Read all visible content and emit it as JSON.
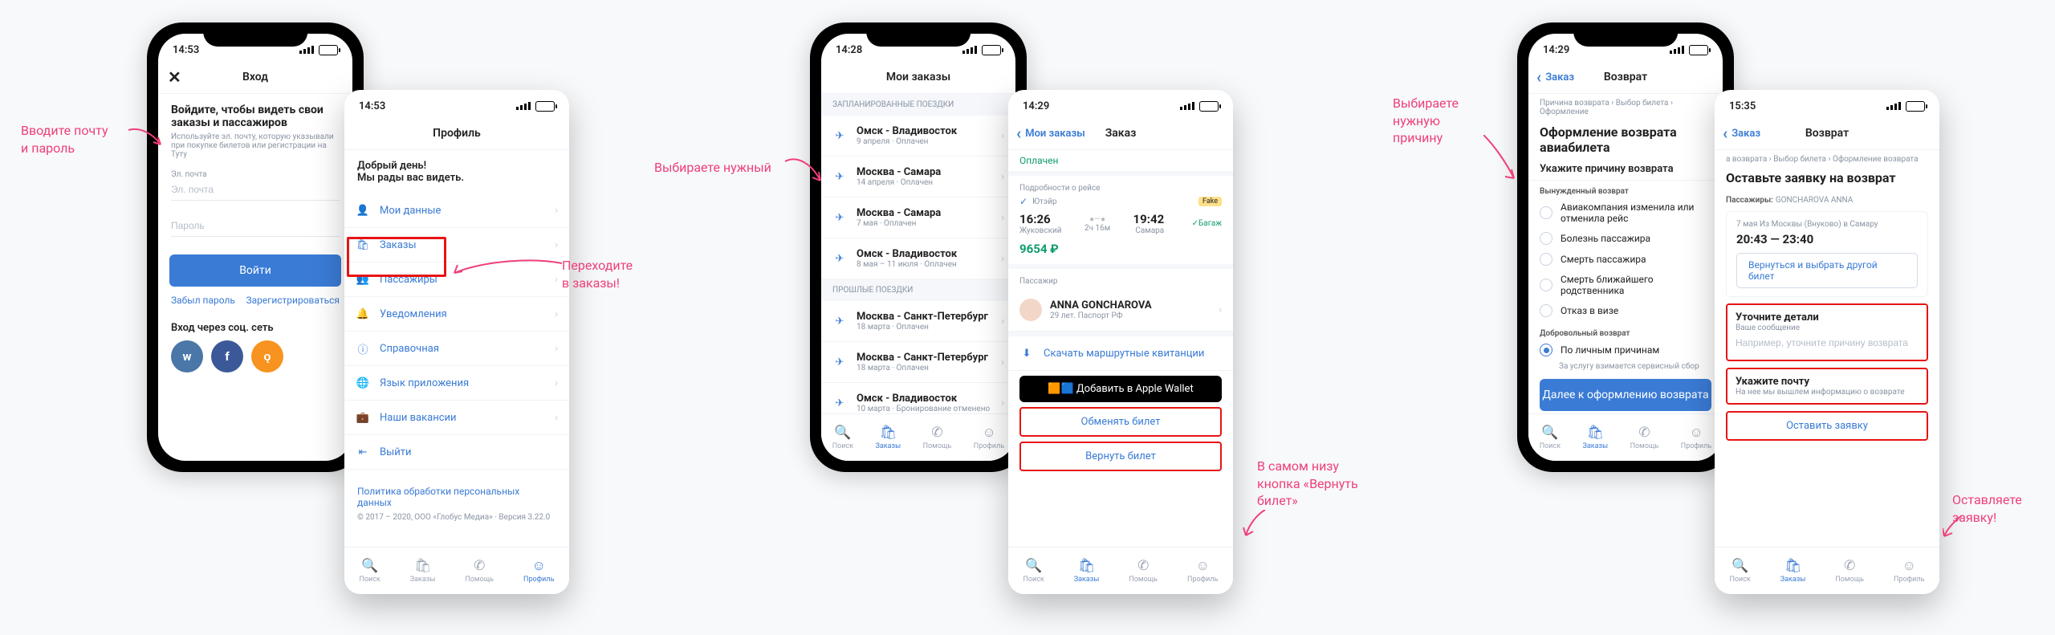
{
  "annotations": {
    "a1": "Вводите почту\nи пароль",
    "a2": "Переходите\nв заказы!",
    "a3": "Выбираете нужный",
    "a4": "В самом низу\nкнопка «Вернуть\nбилет»",
    "a5": "Выбираете\nнужную\nпричину",
    "a6": "Оставляете\nзаявку!"
  },
  "login": {
    "time": "14:53",
    "title": "Вход",
    "heading": "Войдите, чтобы видеть свои\nзаказы и пассажиров",
    "sub": "Используйте эл. почту, которую указывали при покупке билетов или регистрации на Туту",
    "email_label": "Эл. почта",
    "pass_label": "Пароль",
    "btn": "Войти",
    "forgot": "Забыл пароль",
    "register": "Зарегистрироваться",
    "social_label": "Вход через соц. сеть"
  },
  "profile": {
    "time": "14:53",
    "title": "Профиль",
    "greet": "Добрый день!\nМы рады вас видеть.",
    "items": [
      "Мои данные",
      "Заказы",
      "Пассажиры",
      "Уведомления",
      "Справочная",
      "Язык приложения",
      "Наши вакансии",
      "Выйти"
    ],
    "policy": "Политика обработки персональных данных",
    "copyright": "© 2017 – 2020, ООО «Глобус Медиа» · Версия 3.22.0",
    "tabs": [
      "Поиск",
      "Заказы",
      "Помощь",
      "Профиль"
    ]
  },
  "orders": {
    "time": "14:28",
    "title": "Мои заказы",
    "sect1": "ЗАПЛАНИРОВАННЫЕ ПОЕЗДКИ",
    "trips": [
      {
        "route": "Омск - Владивосток",
        "sub": "9 апреля · Оплачен"
      },
      {
        "route": "Москва - Самара",
        "sub": "14 апреля · Оплачен"
      },
      {
        "route": "Москва - Самара",
        "sub": "7 мая · Оплачен"
      },
      {
        "route": "Омск - Владивосток",
        "sub": "8 мая – 11 июля · Оплачен"
      }
    ],
    "sect2": "ПРОШЛЫЕ ПОЕЗДКИ",
    "past": [
      {
        "route": "Москва - Санкт-Петербург",
        "sub": "18 марта · Оплачен"
      },
      {
        "route": "Москва - Санкт-Петербург",
        "sub": "18 марта · Оплачен"
      },
      {
        "route": "Омск - Владивосток",
        "sub": "10 марта · Бронирование отменено"
      }
    ]
  },
  "order": {
    "time": "14:29",
    "back": "Мои заказы",
    "title": "Заказ",
    "status": "Оплачен",
    "detail_head": "Подробности о рейсе",
    "fake": "Fake",
    "carrier": "Ютэйр",
    "dep_t": "16:26",
    "dep_c": "Жуковский",
    "dur": "2ч 16м",
    "arr_t": "19:42",
    "arr_c": "Самара",
    "baggage": "Багаж",
    "price": "9654 ₽",
    "pax_head": "Пассажир",
    "pax_name": "ANNA GONCHAROVA",
    "pax_sub": "29 лет. Паспорт РФ",
    "download": "Скачать маршрутные квитанции",
    "wallet": "Добавить в Apple Wallet",
    "exchange": "Обменять билет",
    "return": "Вернуть билет",
    "tabs": [
      "Поиск",
      "Заказы",
      "Помощь",
      "Профиль"
    ]
  },
  "reason": {
    "time": "14:29",
    "back": "Заказ",
    "title": "Возврат",
    "crumb": "Причина возврата › Выбор билета › Оформление",
    "heading": "Оформление возврата\nавиабилета",
    "prompt": "Укажите причину возврата",
    "forced": "Вынужденный возврат",
    "opts": [
      "Авиакомпания изменила или отменила рейс",
      "Болезнь пассажира",
      "Смерть пассажира",
      "Смерть ближайшего родственника",
      "Отказ в визе"
    ],
    "voluntary": "Добровольный возврат",
    "opt6": "По личным причинам",
    "fee": "За услугу взимается сервисный сбор",
    "next": "Далее к оформлению возврата"
  },
  "request": {
    "time": "15:35",
    "back": "Заказ",
    "title": "Возврат",
    "crumb": "а возврата › Выбор билета › Оформление возврата",
    "heading": "Оставьте заявку на возврат",
    "pax_label": "Пассажиры:",
    "pax": "GONCHAROVA ANNA",
    "trip": "7 мая Из Москвы (Внуково) в Самару",
    "times": "20:43 — 23:40",
    "change": "Вернуться и выбрать другой билет",
    "box1_t": "Уточните детали",
    "box1_l": "Ваше сообщение",
    "box1_ph": "Например, уточните причину возврата",
    "box2_t": "Укажите почту",
    "box2_l": "На нее мы вышлем информацию о возврате",
    "submit": "Оставить заявку",
    "tabs": [
      "Поиск",
      "Заказы",
      "Помощь",
      "Профиль"
    ]
  }
}
